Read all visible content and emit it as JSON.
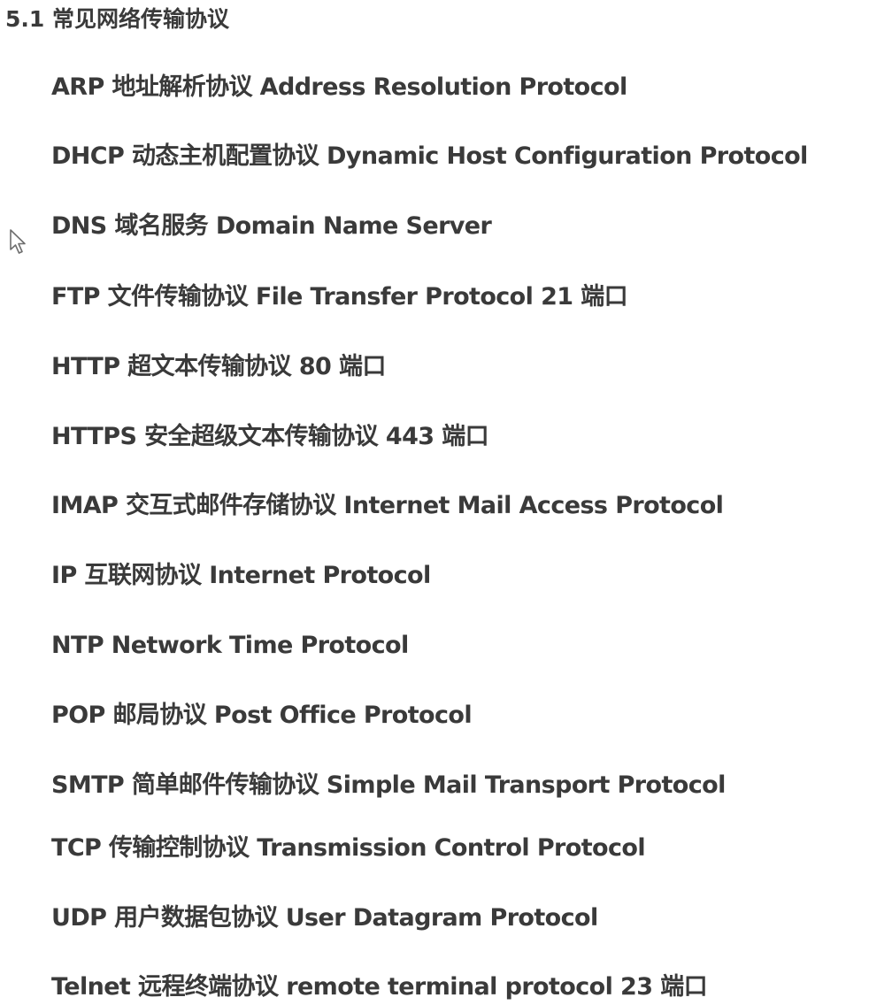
{
  "heading": "5.1 常见网络传输协议",
  "protocols": [
    "ARP 地址解析协议  Address Resolution Protocol",
    "DHCP 动态主机配置协议  Dynamic Host Configuration Protocol",
    "DNS  域名服务  Domain Name Server",
    "FTP  文件传输协议  File Transfer Protocol 21 端口",
    "HTTP  超文本传输协议  80 端口",
    "HTTPS  安全超级文本传输协议  443 端口",
    "IMAP 交互式邮件存储协议 Internet Mail Access Protocol",
    "IP  互联网协议 Internet Protocol",
    "NTP Network Time Protocol",
    "POP  邮局协议  Post Office Protocol",
    "SMTP  简单邮件传输协议  Simple Mail Transport Protocol",
    "TCP  传输控制协议    Transmission Control Protocol",
    "UDP  用户数据包协议    User Datagram Protocol",
    "Telnet  远程终端协议  remote terminal protocol 23 端口"
  ],
  "cursor_icon": "mouse-pointer-icon"
}
